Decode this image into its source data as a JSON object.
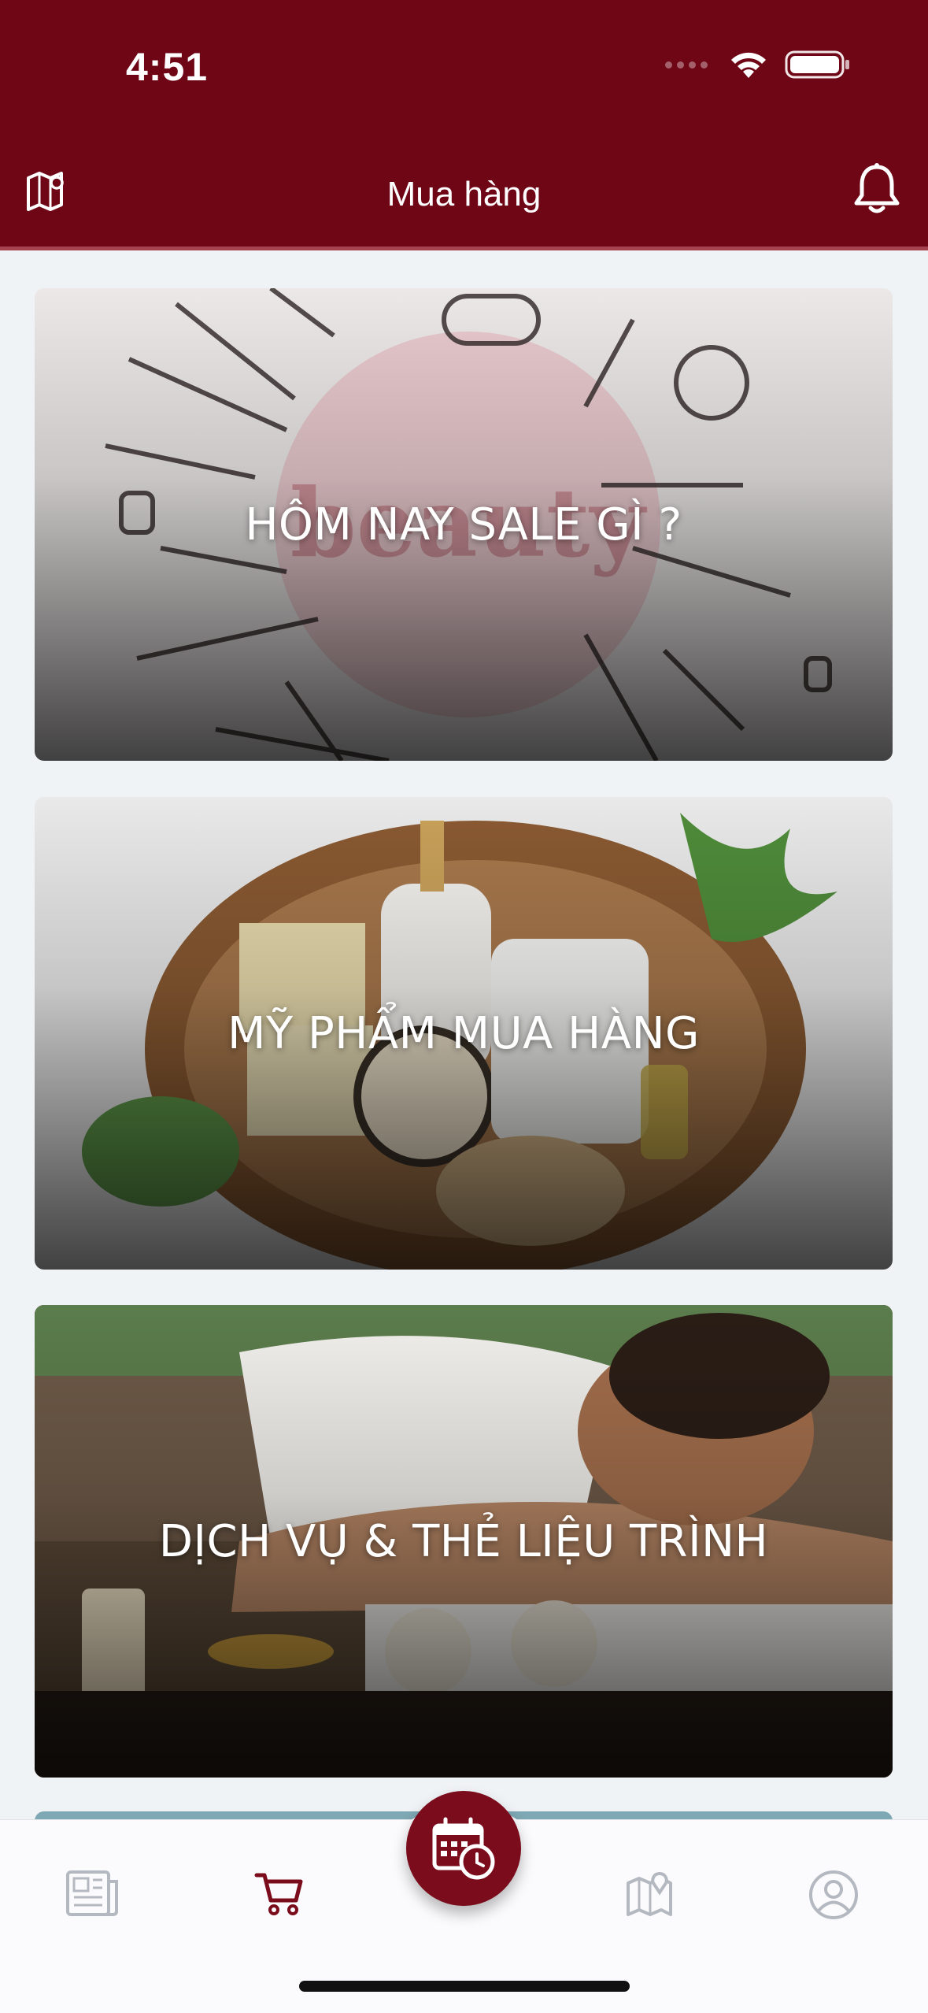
{
  "status_bar": {
    "time": "4:51"
  },
  "header": {
    "title": "Mua hàng"
  },
  "cards": [
    {
      "title": "HÔM NAY SALE GÌ ?"
    },
    {
      "title": "MỸ PHẨM MUA HÀNG"
    },
    {
      "title": "DỊCH VỤ & THẺ LIỆU TRÌNH"
    }
  ],
  "colors": {
    "brand": "#6e0616",
    "accent": "#7a0c1c",
    "tab_inactive": "#b4b8c0"
  },
  "tabbar": {
    "items": [
      {
        "icon": "newspaper-icon",
        "active": false
      },
      {
        "icon": "cart-icon",
        "active": true
      },
      {
        "icon": "calendar-clock-icon",
        "active": false,
        "center": true
      },
      {
        "icon": "map-pin-icon",
        "active": false
      },
      {
        "icon": "user-icon",
        "active": false
      }
    ]
  }
}
